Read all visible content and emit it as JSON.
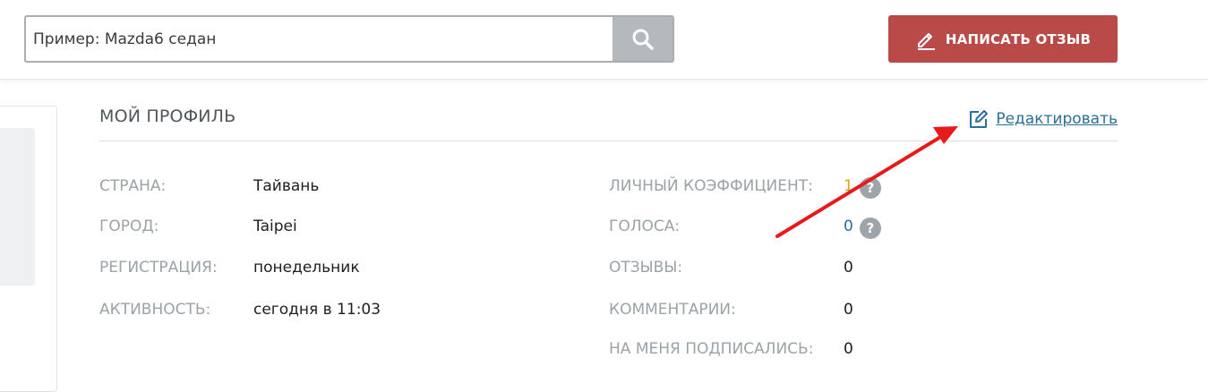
{
  "search": {
    "placeholder": "Пример: Mazda6 седан"
  },
  "header": {
    "write_review_label": "НАПИСАТЬ ОТЗЫВ"
  },
  "profile": {
    "title": "МОЙ ПРОФИЛЬ",
    "edit_label": "Редактировать",
    "left_fields": [
      {
        "label": "СТРАНА:",
        "value": "Тайвань"
      },
      {
        "label": "ГОРОД:",
        "value": "Taipei"
      },
      {
        "label": "РЕГИСТРАЦИЯ:",
        "value": "понедельник"
      },
      {
        "label": "АКТИВНОСТЬ:",
        "value": "сегодня в 11:03"
      }
    ],
    "right_fields": [
      {
        "label": "ЛИЧНЫЙ КОЭФФИЦИЕНТ:",
        "value": "1"
      },
      {
        "label": "ГОЛОСА:",
        "value": "0"
      },
      {
        "label": "ОТЗЫВЫ:",
        "value": "0"
      },
      {
        "label": "КОММЕНТАРИИ:",
        "value": "0"
      },
      {
        "label": "НА МЕНЯ ПОДПИСАЛИСЬ:",
        "value": "0"
      }
    ],
    "help_glyph": "?"
  },
  "colors": {
    "accent_red": "#b94a48",
    "link_blue": "#2a6f96",
    "coef_gold": "#d4a21b",
    "votes_blue": "#2a6f96",
    "annotation_arrow": "#e8191b"
  }
}
